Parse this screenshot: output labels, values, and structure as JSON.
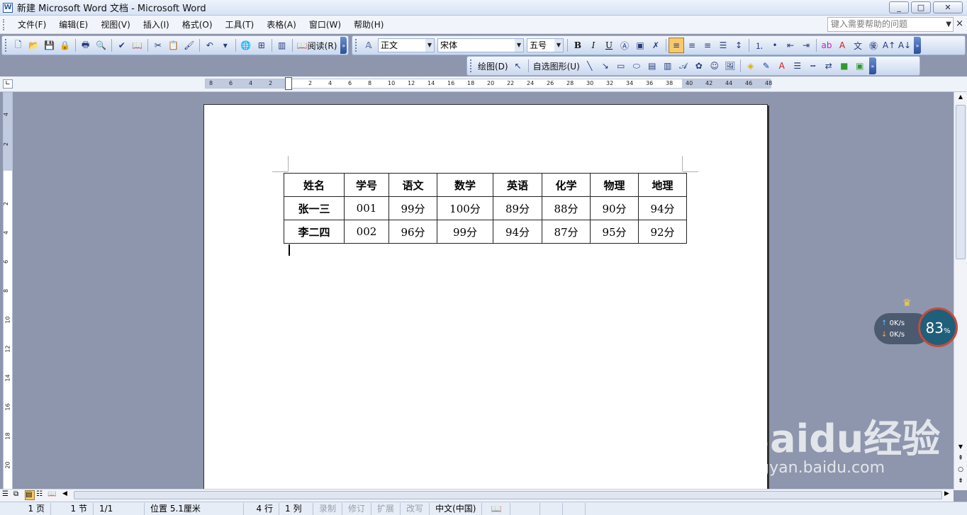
{
  "window": {
    "title": "新建 Microsoft Word 文档 - Microsoft Word",
    "min": "_",
    "max": "□",
    "close": "✕"
  },
  "menu": {
    "items": [
      "文件(F)",
      "编辑(E)",
      "视图(V)",
      "插入(I)",
      "格式(O)",
      "工具(T)",
      "表格(A)",
      "窗口(W)",
      "帮助(H)"
    ],
    "help_placeholder": "键入需要帮助的问题",
    "close": "×"
  },
  "toolbar": {
    "reading_label": "阅读(R)",
    "style_value": "正文",
    "font_value": "宋体",
    "size_value": "五号",
    "bold": "B",
    "italic": "I",
    "underline": "U",
    "draw_label": "绘图(D)",
    "autoshape_label": "自选图形(U)"
  },
  "ruler": {
    "h_ticks": [
      "8",
      "6",
      "4",
      "2",
      "2",
      "4",
      "6",
      "8",
      "10",
      "12",
      "14",
      "16",
      "18",
      "20",
      "22",
      "24",
      "26",
      "28",
      "30",
      "32",
      "34",
      "36",
      "38",
      "40",
      "42",
      "44",
      "46",
      "48"
    ],
    "v_ticks": [
      "4",
      "2",
      "2",
      "4",
      "6",
      "8",
      "10",
      "12",
      "14",
      "16",
      "18",
      "20"
    ]
  },
  "document": {
    "table": {
      "headers": [
        "姓名",
        "学号",
        "语文",
        "数学",
        "英语",
        "化学",
        "物理",
        "地理"
      ],
      "rows": [
        [
          "张一三",
          "001",
          "99分",
          "100分",
          "89分",
          "88分",
          "90分",
          "94分"
        ],
        [
          "李二四",
          "002",
          "96分",
          "99分",
          "94分",
          "87分",
          "95分",
          "92分"
        ]
      ]
    }
  },
  "status": {
    "page": "1 页",
    "section": "1 节",
    "pages": "1/1",
    "position": "位置 5.1厘米",
    "line": "4 行",
    "column": "1 列",
    "rec": "录制",
    "trk": "修订",
    "ext": "扩展",
    "ovr": "改写",
    "language": "中文(中国)"
  },
  "net_widget": {
    "up": "0K/s",
    "down": "0K/s",
    "percent": "83",
    "unit": "%"
  },
  "watermark": {
    "logo": "Baidu经验",
    "url": "jingyan.baidu.com"
  },
  "colors": {
    "accent": "#2a5aa8",
    "highlight": "#f7c96a",
    "workspace": "#8d96ad"
  }
}
